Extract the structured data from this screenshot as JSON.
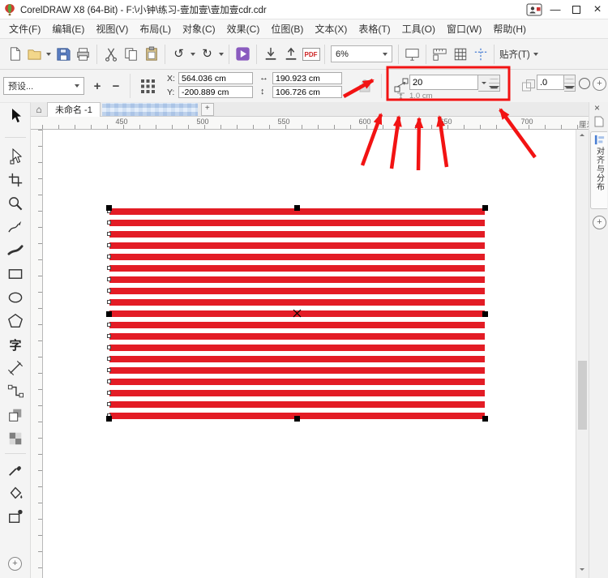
{
  "window": {
    "title": "CorelDRAW X8 (64-Bit) - F:\\小钟\\练习-壹加壹\\壹加壹cdr.cdr"
  },
  "glyphs": {
    "minimize": "—",
    "close": "×",
    "home": "⌂",
    "plus": "+",
    "minus": "−",
    "width_arrow": "↔",
    "height_arrow": "↕"
  },
  "menu": {
    "items": {
      "file": "文件(F)",
      "edit": "编辑(E)",
      "view": "视图(V)",
      "layout": "布局(L)",
      "object": "对象(C)",
      "effects": "效果(C)",
      "bitmaps": "位图(B)",
      "text": "文本(X)",
      "table": "表格(T)",
      "tools": "工具(O)",
      "window": "窗口(W)",
      "help": "帮助(H)"
    }
  },
  "toolbar": {
    "undo_glyph": "↺",
    "redo_glyph": "↻",
    "pdf_label": "PDF",
    "zoom_level": "6%",
    "snap_label": "贴齐(T)"
  },
  "property_bar": {
    "preset_placeholder": "预设...",
    "x_label": "X:",
    "x_value": "564.036 cm",
    "y_label": "Y:",
    "y_value": "-200.889 cm",
    "width_value": "190.923 cm",
    "height_value": "106.726 cm",
    "steps_value": "20",
    "spacing_value": "1.0 cm",
    "direction_value": ".0"
  },
  "tabbar": {
    "document_tab": "未命名 -1"
  },
  "ruler": {
    "ticks": [
      "450",
      "500",
      "550",
      "600",
      "650",
      "700"
    ],
    "unit": "厘米"
  },
  "toolbox": {
    "text_glyph": "字"
  },
  "docker": {
    "tab_label": "对齐与分布"
  },
  "canvas": {
    "stripe_count": 19,
    "stripe_color": "#e31c25"
  },
  "colors": {
    "annotation_red": "#f21313",
    "highlight_box_red": "#f21313"
  }
}
